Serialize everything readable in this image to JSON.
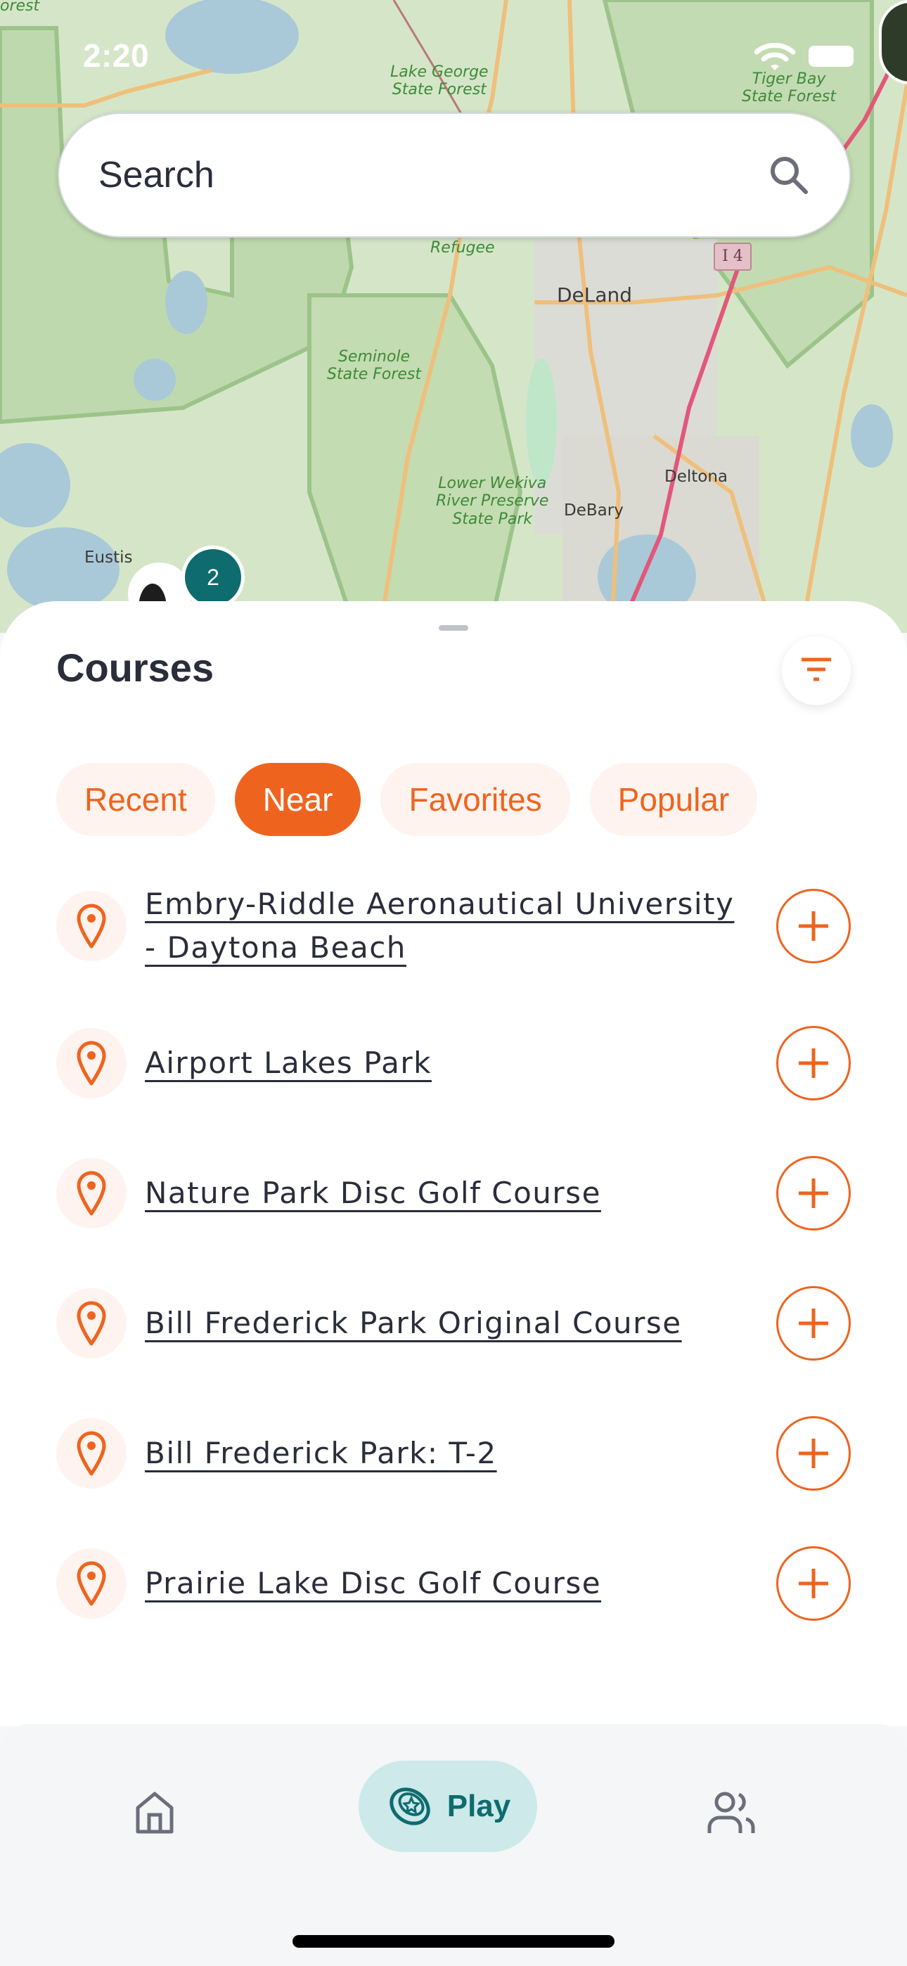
{
  "status_bar": {
    "time": "2:20"
  },
  "map": {
    "labels": {
      "forest_top_left": "orest",
      "lake_george": "Lake George\nState Forest",
      "tiger_bay": "Tiger Bay\nState Forest",
      "refugee": "Refugee",
      "seminole": "Seminole\nState Forest",
      "lower_wekiva": "Lower Wekiva\nRiver Preserve\nState Park"
    },
    "cities": {
      "deland": "DeLand",
      "deltona": "Deltona",
      "debary": "DeBary",
      "eustis": "Eustis"
    },
    "highway_shield": "I 4",
    "cluster_count": "2"
  },
  "search": {
    "placeholder": "Search",
    "value": ""
  },
  "sheet": {
    "title": "Courses",
    "filter_icon": "filter-icon",
    "chips": [
      {
        "label": "Recent",
        "active": false
      },
      {
        "label": "Near",
        "active": true
      },
      {
        "label": "Favorites",
        "active": false
      },
      {
        "label": "Popular",
        "active": false
      }
    ],
    "courses": [
      {
        "name": "Embry-Riddle Aeronautical University - Daytona Beach"
      },
      {
        "name": "Airport Lakes Park"
      },
      {
        "name": "Nature Park Disc Golf Course"
      },
      {
        "name": "Bill Frederick Park Original Course"
      },
      {
        "name": "Bill Frederick Park: T-2"
      },
      {
        "name": "Prairie Lake Disc Golf Course"
      }
    ]
  },
  "nav": {
    "items": [
      {
        "icon": "home-icon",
        "label": ""
      },
      {
        "icon": "disc-icon",
        "label": "Play",
        "active": true
      },
      {
        "icon": "friends-icon",
        "label": ""
      }
    ]
  },
  "colors": {
    "accent": "#ee641f",
    "accent_soft": "#fef3ee",
    "teal": "#0e6b6e",
    "teal_soft": "#cde9ea",
    "text": "#2a2d3a"
  }
}
